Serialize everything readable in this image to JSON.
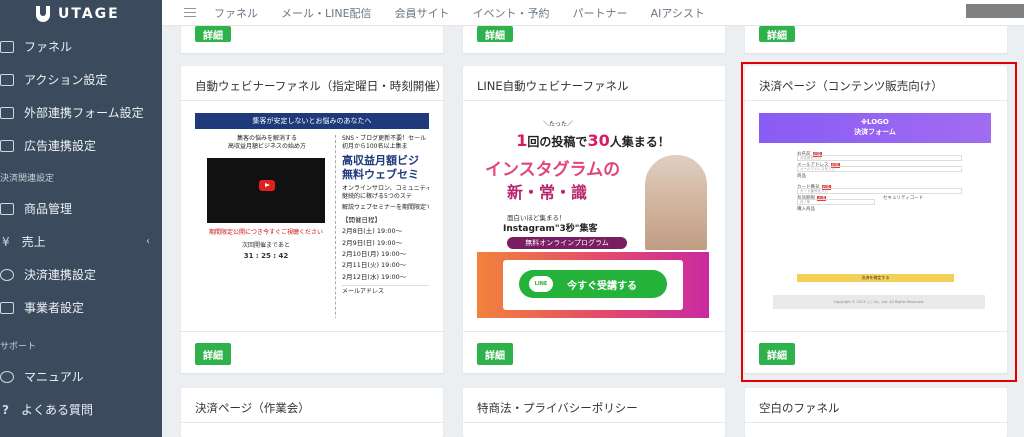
{
  "sidebar": {
    "brand": "UTAGE",
    "items": [
      {
        "label": "ファネル",
        "icon": "funnel-icon"
      },
      {
        "label": "アクション設定",
        "icon": "action-icon"
      },
      {
        "label": "外部連携フォーム設定",
        "icon": "form-icon"
      },
      {
        "label": "広告連携設定",
        "icon": "megaphone-icon"
      }
    ],
    "section_payment": "決済関連設定",
    "payment_items": [
      {
        "label": "商品管理",
        "icon": "product-icon"
      },
      {
        "label": "売上",
        "icon": "yen-icon",
        "chevron": "‹"
      },
      {
        "label": "決済連携設定",
        "icon": "gear-icon"
      },
      {
        "label": "事業者設定",
        "icon": "business-icon"
      }
    ],
    "section_support": "サポート",
    "support_items": [
      {
        "label": "マニュアル",
        "icon": "manual-icon"
      },
      {
        "label": "よくある質問",
        "icon": "question-icon"
      }
    ]
  },
  "topbar": {
    "nav": [
      "ファネル",
      "メール・LINE配信",
      "会員サイト",
      "イベント・予約",
      "パートナー",
      "AIアシスト"
    ]
  },
  "cards": {
    "detail_label": "詳細",
    "card1": {
      "title": "自動ウェビナーファネル（指定曜日・時刻開催）",
      "thumb": {
        "banner": "集客が安定しないとお悩みのあなたへ",
        "left_title": "集客の悩みを解消する\n高収益月額ビジネスの始め方",
        "red_text": "期間限定公開につき今すぐご視聴ください",
        "timer_label": "次回開催まであと",
        "timer": "31 : 25 : 42",
        "right_intro": "SNS・ブログ更新不要！セール\n初月から100名以上集ま",
        "right_big": "高収益月額ビジ\n無料ウェブセミ",
        "right_mid": "オンラインサロン、コミュニティ\n継続的に稼げる5つのステ",
        "right_app": "解説ウェブセミナーを期間限定で",
        "dates_head": "【開催日程】",
        "dates": [
          "2月8日(土) 19:00〜",
          "2月9日(日) 19:00〜",
          "2月10日(月) 19:00〜",
          "2月11日(火) 19:00〜",
          "2月12日(水) 19:00〜"
        ],
        "email_label": "メールアドレス"
      }
    },
    "card2": {
      "title": "LINE自動ウェビナーファネル",
      "thumb": {
        "small": "＼たった／",
        "line1_a": "1",
        "line1_b": "回の投稿で",
        "line1_c": "30",
        "line1_d": "人集まる！",
        "line2": "インスタグラムの",
        "line3": "新・常・識",
        "line4": "面白いほど集まる！",
        "line5": "Instagram\"3秒\"集客",
        "pill": "無料オンラインプログラム",
        "cta": "今すぐ受講する",
        "line_icon": "LINE"
      }
    },
    "card3": {
      "title": "決済ページ（コンテンツ販売向け）",
      "thumb": {
        "logo": "✤LOGO",
        "heading": "決済フォーム",
        "fields": [
          {
            "label": "お名前",
            "tag": "必須",
            "placeholder": "お名前を入力"
          },
          {
            "label": "メールアドレス",
            "tag": "必須",
            "placeholder": "メールアドレスを入力"
          },
          {
            "label": "商品",
            "tag": "",
            "placeholder": ""
          },
          {
            "label": "カード番号",
            "tag": "必須",
            "placeholder": "カード番号を入力"
          },
          {
            "label": "有効期限",
            "tag": "必須",
            "placeholder": "月 / 年"
          },
          {
            "label": "購入商品",
            "tag": "",
            "placeholder": ""
          }
        ],
        "security_label": "セキュリティコード",
        "submit": "決済を確定する",
        "footer": "Copyright © 2023 ○○ Co., Ltd. All Rights Reserved."
      }
    },
    "row3": [
      "決済ページ（作業会）",
      "特商法・プライバシーポリシー",
      "空白のファネル"
    ]
  },
  "colors": {
    "sidebar": "#3b4a5c",
    "button": "#2fb24c",
    "highlight": "#e20000",
    "banner": "#1f3a7a"
  }
}
